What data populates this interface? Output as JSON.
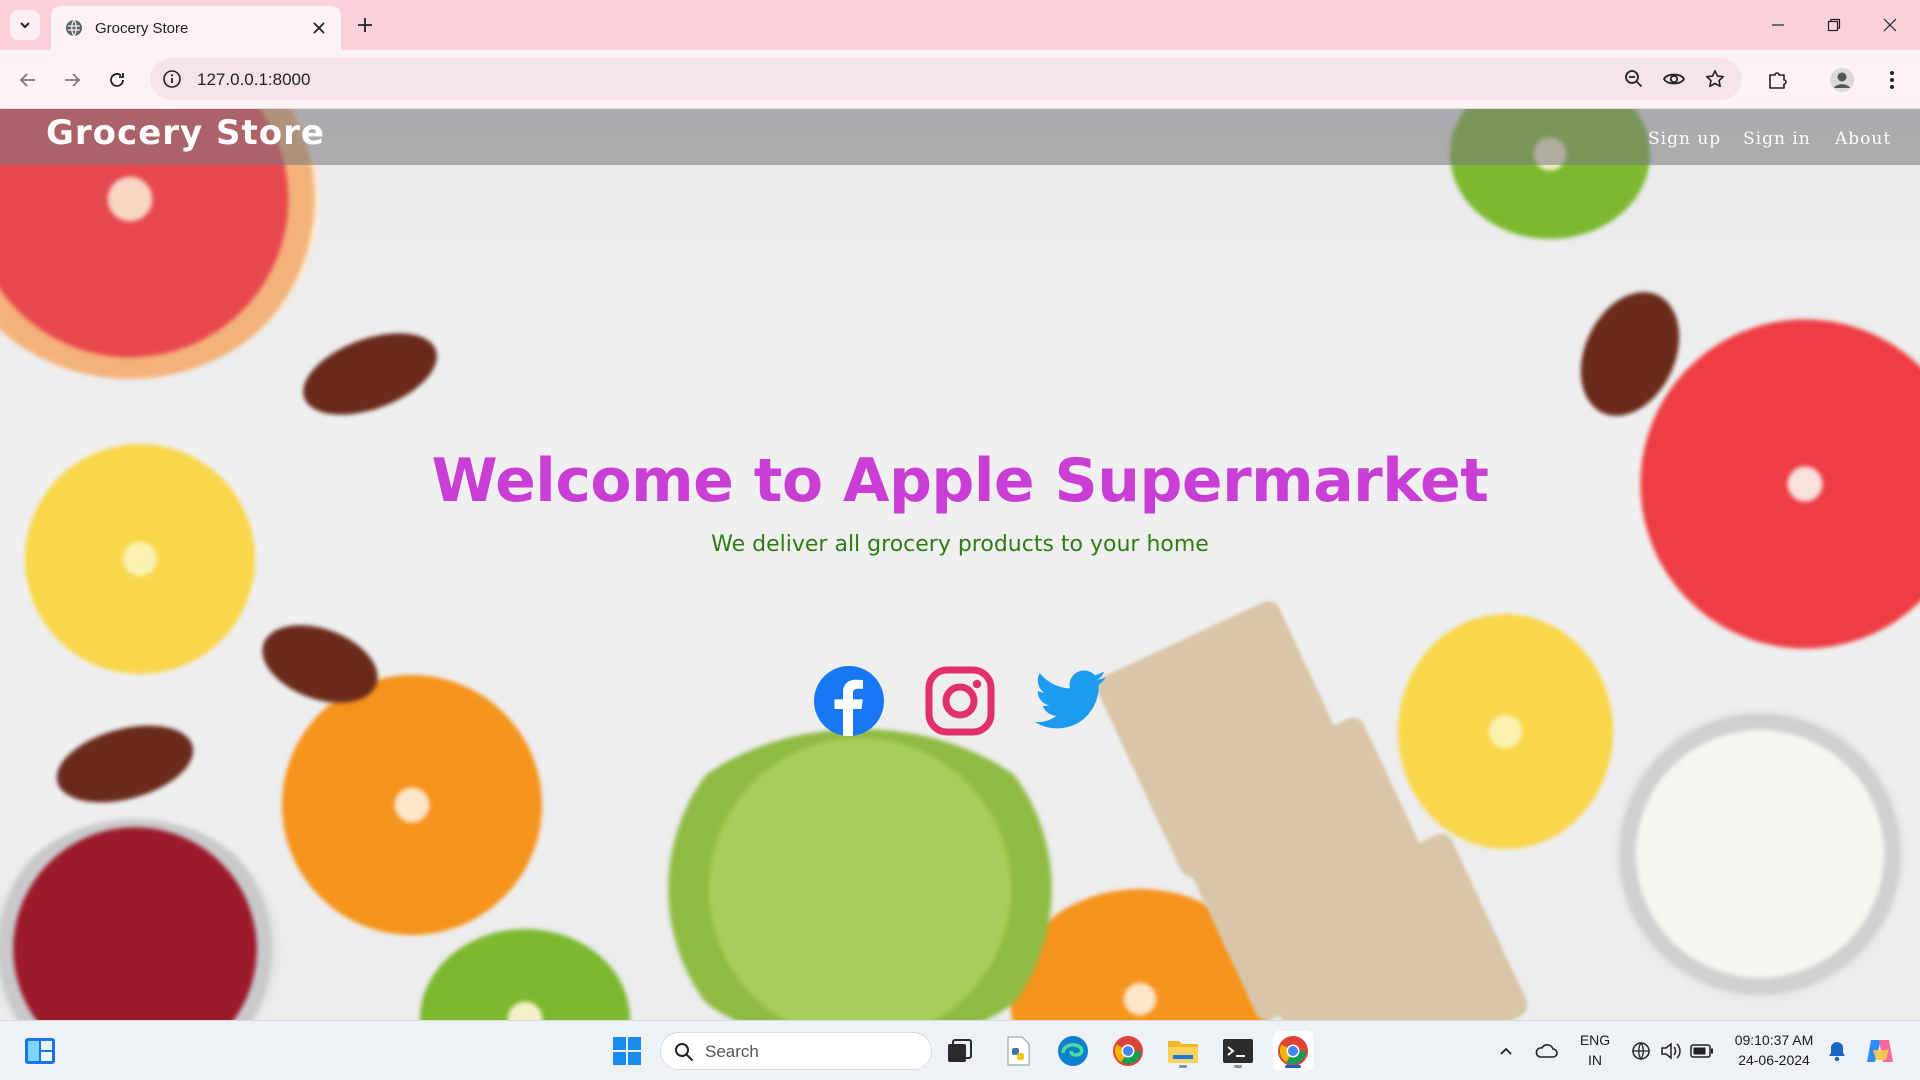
{
  "browser": {
    "tab_title": "Grocery Store",
    "url": "127.0.0.1:8000"
  },
  "site": {
    "brand": "Grocery Store",
    "nav": [
      "Sign up",
      "Sign in",
      "About"
    ],
    "hero_title": "Welcome to Apple Supermarket",
    "hero_subtitle": "We deliver all grocery products to your home",
    "social": [
      "facebook-icon",
      "instagram-icon",
      "twitter-icon"
    ]
  },
  "taskbar": {
    "search_placeholder": "Search",
    "lang_line1": "ENG",
    "lang_line2": "IN",
    "time": "09:10:37 AM",
    "date": "24-06-2024"
  },
  "colors": {
    "hero_title": "#c93fd6",
    "hero_subtitle": "#2d7d15",
    "facebook": "#1877f2",
    "instagram": "#e1306c",
    "twitter": "#1da1f2"
  }
}
